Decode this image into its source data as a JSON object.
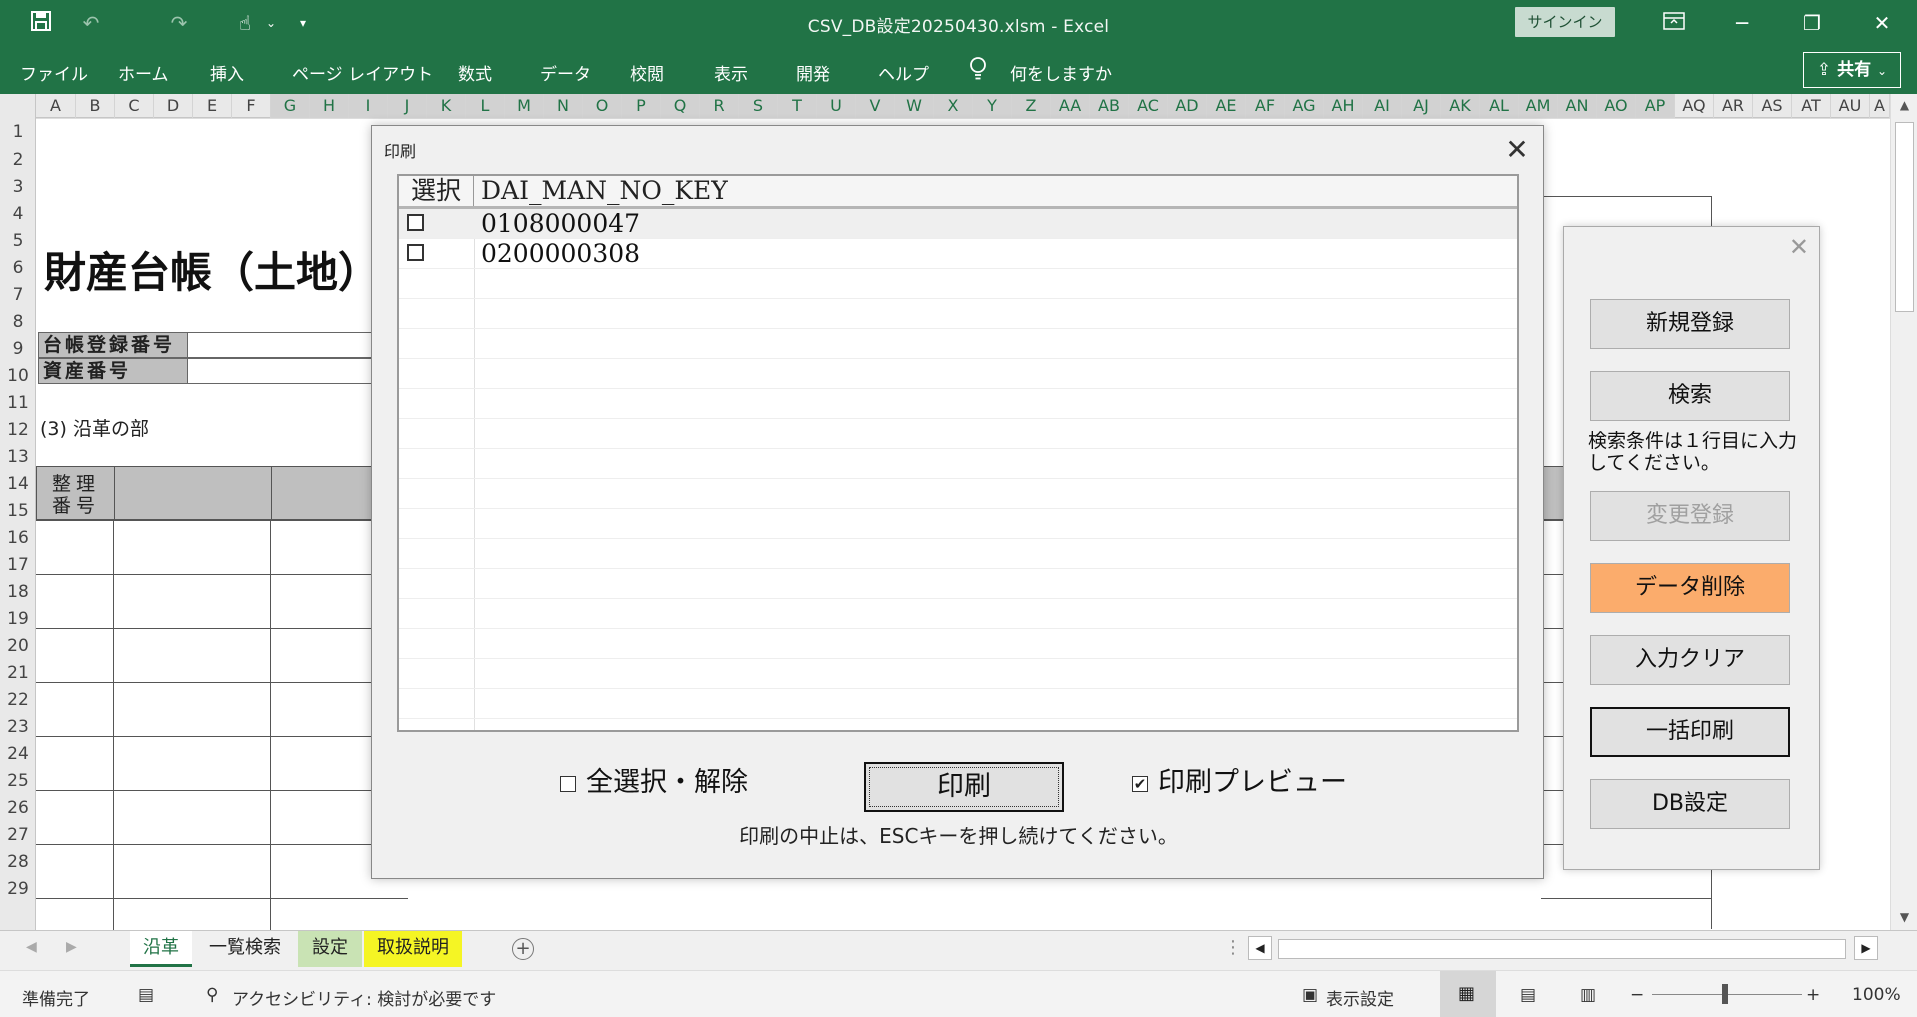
{
  "app": {
    "title": "CSV_DB設定20250430.xlsm  -  Excel",
    "signin": "サインイン",
    "share": "共有",
    "tell_me": "何をしますか"
  },
  "ribbon_tabs": [
    "ファイル",
    "ホーム",
    "挿入",
    "ページ レイアウト",
    "数式",
    "データ",
    "校閲",
    "表示",
    "開発",
    "ヘルプ"
  ],
  "columns": [
    "A",
    "B",
    "C",
    "D",
    "E",
    "F",
    "G",
    "H",
    "I",
    "J",
    "K",
    "L",
    "M",
    "N",
    "O",
    "P",
    "Q",
    "R",
    "S",
    "T",
    "U",
    "V",
    "W",
    "X",
    "Y",
    "Z",
    "AA",
    "AB",
    "AC",
    "AD",
    "AE",
    "AF",
    "AG",
    "AH",
    "AI",
    "AJ",
    "AK",
    "AL",
    "AM",
    "AN",
    "AO",
    "AP",
    "AQ",
    "AR",
    "AS",
    "AT",
    "AU",
    "A"
  ],
  "rows": [
    "1",
    "2",
    "3",
    "4",
    "5",
    "6",
    "7",
    "8",
    "9",
    "10",
    "11",
    "12",
    "13",
    "14",
    "15",
    "16",
    "17",
    "18",
    "19",
    "20",
    "21",
    "22",
    "23",
    "24",
    "25",
    "26",
    "27",
    "28",
    "29"
  ],
  "sheet": {
    "title": "財産台帳（土地）",
    "register_no_label": "台帳登録番号",
    "asset_no_label": "資産番号",
    "section": "(3) 沿革の部",
    "header_seiri": "整理",
    "header_bango": "番号"
  },
  "sheet_tabs": [
    {
      "label": "沿革",
      "active": true
    },
    {
      "label": "一覧検索",
      "active": false
    },
    {
      "label": "設定",
      "active": false
    },
    {
      "label": "取扱説明",
      "active": false
    }
  ],
  "status": {
    "ready": "準備完了",
    "accessibility": "アクセシビリティ: 検討が必要です",
    "display_settings": "表示設定",
    "zoom": "100%"
  },
  "dialog": {
    "title": "印刷",
    "close": "✕",
    "col_select": "選択",
    "col_key": "DAI_MAN_NO_KEY",
    "rows": [
      {
        "checked": false,
        "key": "0108000047"
      },
      {
        "checked": false,
        "key": "0200000308"
      }
    ],
    "select_all_label": "全選択・解除",
    "select_all_checked": false,
    "print_button": "印刷",
    "preview_label": "印刷プレビュー",
    "preview_checked": true,
    "esc_note": "印刷の中止は、ESCキーを押し続けてください。"
  },
  "panel": {
    "close": "✕",
    "new_register": "新規登録",
    "search": "検索",
    "search_note": "検索条件は１行目に入力してください。",
    "modify": "変更登録",
    "delete": "データ削除",
    "clear": "入力クリア",
    "batch_print": "一括印刷",
    "db_settings": "DB設定"
  },
  "colors": {
    "excel_green": "#217346",
    "delete_orange": "#fbac6c",
    "tab_green": "#c9e3b4",
    "tab_yellow": "#f5f524"
  }
}
